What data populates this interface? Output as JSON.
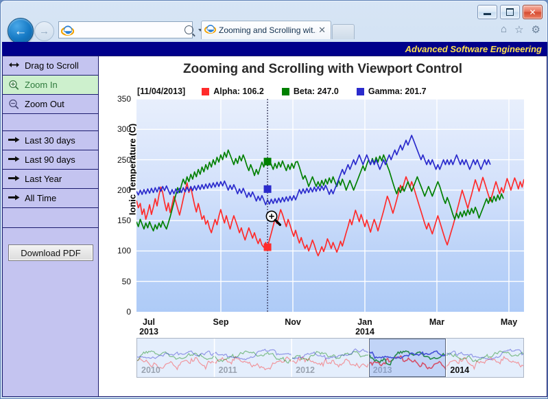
{
  "window": {
    "minimize_label": "Minimize",
    "maximize_label": "Maximize",
    "close_label": "✕"
  },
  "browser": {
    "back_glyph": "←",
    "forward_glyph": "→",
    "address_value": "",
    "address_placeholder": "",
    "search_icon": "search-icon",
    "refresh_glyph": "↻",
    "tab_title": "Zooming and Scrolling wit...",
    "tab_close_glyph": "✕",
    "home_glyph": "⌂",
    "favorites_glyph": "☆",
    "tools_glyph": "⚙"
  },
  "brand": {
    "text": "Advanced Software Engineering",
    "bg": "#00008b",
    "fg": "#ffe14d"
  },
  "sidebar": {
    "bg": "#c4c4f0",
    "selected_bg": "#cdf0cd",
    "items": [
      {
        "label": "Drag to Scroll",
        "icon": "drag-horizontal-icon",
        "selected": false
      },
      {
        "label": "Zoom In",
        "icon": "zoom-in-icon",
        "selected": true
      },
      {
        "label": "Zoom Out",
        "icon": "zoom-out-icon",
        "selected": false
      }
    ],
    "range_items": [
      {
        "label": "Last 30 days",
        "icon": "arrow-right-icon"
      },
      {
        "label": "Last 90 days",
        "icon": "arrow-right-icon"
      },
      {
        "label": "Last Year",
        "icon": "arrow-right-icon"
      },
      {
        "label": "All Time",
        "icon": "arrow-right-icon"
      }
    ],
    "download_label": "Download PDF"
  },
  "chart_data": {
    "type": "line",
    "title": "Zooming and Scrolling with Viewport Control",
    "xlabel": "",
    "ylabel": "Ionic Temperature (C)",
    "ylim": [
      0,
      350
    ],
    "yticks": [
      0,
      50,
      100,
      150,
      200,
      250,
      300,
      350
    ],
    "grid": true,
    "legend_position": "top",
    "tracker_date": "[11/04/2013]",
    "xticks": [
      {
        "label": "Jul",
        "sub": "2013"
      },
      {
        "label": "Sep",
        "sub": ""
      },
      {
        "label": "Nov",
        "sub": ""
      },
      {
        "label": "Jan",
        "sub": "2014"
      },
      {
        "label": "Mar",
        "sub": ""
      },
      {
        "label": "May",
        "sub": ""
      }
    ],
    "series": [
      {
        "name": "Alpha",
        "color": "#ff2b2b",
        "tracker_value": "106.2",
        "legend_text": "Alpha: 106.2",
        "values": [
          183,
          171,
          178,
          160,
          169,
          152,
          163,
          176,
          160,
          172,
          186,
          174,
          192,
          205,
          196,
          180,
          166,
          179,
          163,
          176,
          190,
          181,
          170,
          159,
          172,
          186,
          200,
          212,
          196,
          205,
          190,
          176,
          164,
          178,
          166,
          152,
          158,
          144,
          150,
          138,
          130,
          141,
          152,
          143,
          157,
          168,
          156,
          146,
          158,
          147,
          136,
          148,
          158,
          149,
          140,
          130,
          138,
          127,
          118,
          128,
          138,
          130,
          121,
          130,
          120,
          112,
          120,
          110,
          106,
          114,
          106,
          118,
          129,
          141,
          153,
          145,
          156,
          168,
          160,
          150,
          140,
          152,
          143,
          133,
          124,
          134,
          123,
          113,
          122,
          112,
          104,
          110,
          100,
          108,
          118,
          110,
          100,
          92,
          99,
          107,
          99,
          108,
          120,
          113,
          104,
          114,
          106,
          98,
          106,
          116,
          108,
          119,
          130,
          140,
          152,
          143,
          155,
          167,
          158,
          148,
          160,
          150,
          140,
          151,
          141,
          131,
          142,
          152,
          143,
          133,
          144,
          155,
          166,
          178,
          190,
          182,
          172,
          162,
          173,
          184,
          196,
          208,
          200,
          212,
          222,
          214,
          204,
          214,
          205,
          195,
          185,
          175,
          165,
          155,
          145,
          136,
          146,
          137,
          128,
          138,
          148,
          158,
          148,
          138,
          128,
          118,
          110,
          120,
          131,
          141,
          152,
          164,
          176,
          188,
          200,
          190,
          180,
          170,
          182,
          193,
          205,
          217,
          208,
          198,
          210,
          221,
          212,
          202,
          192,
          182,
          192,
          203,
          214,
          204,
          194,
          204,
          196,
          208,
          219,
          210,
          200,
          210,
          220,
          212,
          202,
          214,
          205,
          218
        ]
      },
      {
        "name": "Beta",
        "color": "#008000",
        "tracker_value": "247.0",
        "legend_text": "Beta: 247.0",
        "values": [
          148,
          140,
          152,
          144,
          136,
          146,
          138,
          148,
          140,
          133,
          143,
          136,
          146,
          139,
          149,
          142,
          136,
          146,
          156,
          168,
          180,
          192,
          204,
          196,
          208,
          218,
          210,
          222,
          214,
          226,
          218,
          230,
          222,
          234,
          226,
          238,
          230,
          242,
          234,
          246,
          238,
          250,
          242,
          254,
          246,
          258,
          250,
          262,
          254,
          266,
          258,
          250,
          242,
          252,
          244,
          256,
          248,
          258,
          250,
          240,
          232,
          242,
          234,
          224,
          234,
          226,
          236,
          246,
          238,
          248,
          240,
          250,
          242,
          234,
          244,
          236,
          246,
          238,
          248,
          240,
          232,
          242,
          234,
          244,
          236,
          246,
          247,
          238,
          228,
          218,
          224,
          216,
          206,
          214,
          222,
          214,
          206,
          214,
          206,
          216,
          208,
          218,
          210,
          220,
          212,
          222,
          214,
          206,
          216,
          208,
          218,
          210,
          200,
          208,
          216,
          208,
          200,
          208,
          216,
          224,
          232,
          240,
          232,
          242,
          250,
          242,
          252,
          244,
          254,
          246,
          256,
          248,
          258,
          250,
          240,
          232,
          222,
          212,
          202,
          194,
          204,
          196,
          206,
          198,
          206,
          214,
          206,
          198,
          206,
          214,
          222,
          214,
          206,
          198,
          190,
          198,
          206,
          198,
          190,
          198,
          206,
          214,
          206,
          196,
          186,
          178,
          188,
          180,
          170,
          160,
          152,
          162,
          154,
          164,
          156,
          166,
          158,
          168,
          160,
          170,
          162,
          172,
          164,
          154,
          162,
          170,
          178,
          186,
          178,
          188,
          180,
          190,
          182,
          192,
          184,
          194,
          186
        ]
      },
      {
        "name": "Gamma",
        "color": "#2b2bcc",
        "tracker_value": "201.7",
        "legend_text": "Gamma: 201.7",
        "values": [
          198,
          192,
          200,
          193,
          201,
          194,
          202,
          195,
          203,
          196,
          204,
          197,
          205,
          198,
          206,
          199,
          207,
          200,
          193,
          201,
          194,
          202,
          195,
          203,
          196,
          204,
          197,
          205,
          198,
          206,
          199,
          207,
          200,
          208,
          201,
          209,
          202,
          210,
          203,
          211,
          204,
          212,
          205,
          213,
          206,
          214,
          207,
          215,
          208,
          200,
          208,
          201,
          209,
          202,
          194,
          202,
          195,
          203,
          196,
          188,
          196,
          189,
          197,
          190,
          182,
          190,
          183,
          191,
          184,
          176,
          184,
          177,
          185,
          178,
          186,
          179,
          187,
          180,
          188,
          181,
          189,
          182,
          190,
          183,
          191,
          184,
          192,
          201,
          194,
          202,
          195,
          203,
          196,
          204,
          197,
          205,
          198,
          206,
          199,
          207,
          200,
          208,
          201,
          193,
          201,
          194,
          202,
          210,
          218,
          226,
          234,
          226,
          234,
          242,
          234,
          242,
          250,
          242,
          250,
          258,
          250,
          242,
          250,
          258,
          250,
          242,
          250,
          242,
          250,
          242,
          234,
          242,
          250,
          242,
          250,
          258,
          250,
          258,
          266,
          258,
          266,
          274,
          266,
          274,
          282,
          274,
          282,
          290,
          282,
          274,
          266,
          258,
          250,
          258,
          250,
          242,
          250,
          242,
          250,
          242,
          234,
          242,
          234,
          242,
          250,
          242,
          250,
          242,
          250,
          242,
          250,
          258,
          250,
          242,
          250,
          242,
          250,
          242,
          234,
          242,
          250,
          242,
          250,
          242,
          234,
          242,
          250,
          242,
          250,
          242
        ]
      }
    ],
    "tracker_index": 70,
    "tracker_markers": [
      {
        "series": "Alpha",
        "value": 106.2,
        "color": "#ff2b2b"
      },
      {
        "series": "Beta",
        "value": 247.0,
        "color": "#008000"
      },
      {
        "series": "Gamma",
        "value": 201.7,
        "color": "#2b2bcc"
      }
    ],
    "viewport": {
      "year_labels": [
        "2010",
        "2011",
        "2012",
        "2013",
        "2014"
      ],
      "active_year": "2014",
      "selection_start_pct": 60,
      "selection_end_pct": 80
    }
  },
  "cursor": {
    "icon": "zoom-in-cursor"
  }
}
